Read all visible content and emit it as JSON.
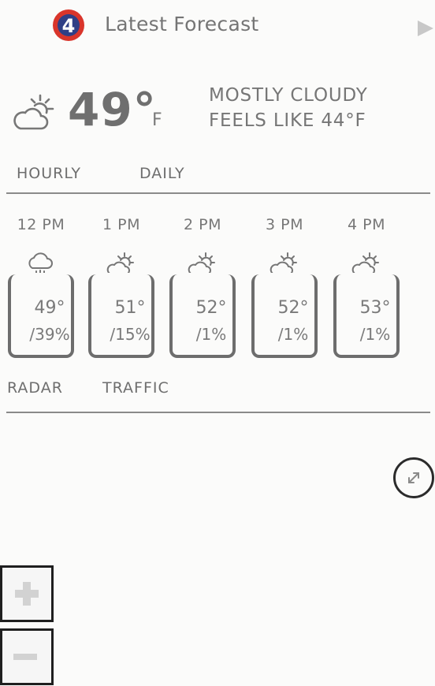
{
  "header": {
    "logo": "channel-4-logo",
    "title": "Latest Forecast",
    "play_icon": "play-icon"
  },
  "current": {
    "icon": "partly-cloudy-icon",
    "temp": "49°",
    "unit": "F",
    "condition": "MOSTLY CLOUDY",
    "feels_like": "FEELS LIKE 44°F"
  },
  "forecast_tabs": [
    "HOURLY",
    "DAILY"
  ],
  "hourly": [
    {
      "time": "12 PM",
      "icon": "rain-cloud-icon",
      "temp": "49°",
      "precip": "39%"
    },
    {
      "time": "1 PM",
      "icon": "partly-cloudy-icon",
      "temp": "51°",
      "precip": "15%"
    },
    {
      "time": "2 PM",
      "icon": "partly-cloudy-icon",
      "temp": "52°",
      "precip": "1%"
    },
    {
      "time": "3 PM",
      "icon": "partly-cloudy-icon",
      "temp": "52°",
      "precip": "1%"
    },
    {
      "time": "4 PM",
      "icon": "partly-cloudy-icon",
      "temp": "53°",
      "precip": "1%"
    }
  ],
  "map_tabs": [
    "RADAR",
    "TRAFFIC"
  ],
  "map_controls": {
    "expand_icon": "expand-icon",
    "zoom_in_icon": "plus-icon",
    "zoom_out_icon": "minus-icon"
  },
  "colors": {
    "text": "#777777",
    "logo_red": "#d9352b",
    "logo_blue": "#2f3f86"
  }
}
